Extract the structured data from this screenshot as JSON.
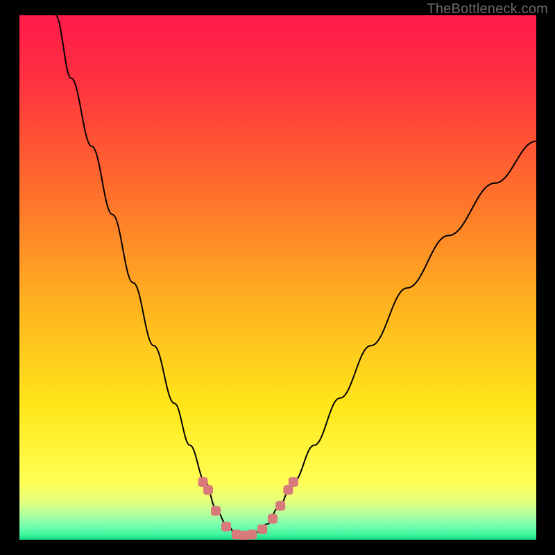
{
  "watermark": "TheBottleneck.com",
  "gradient": {
    "c0": "#ff1a4a",
    "c1": "#ff3040",
    "c2": "#ff6a2d",
    "c3": "#ffb21f",
    "c4": "#ffe81a",
    "c5": "#ffff55",
    "c6": "#e8ff7a",
    "c7": "#b6ff9a",
    "c8": "#7fffb0",
    "c9": "#40f7a0",
    "c10": "#17d884"
  },
  "chart_data": {
    "type": "line",
    "title": "",
    "xlabel": "",
    "ylabel": "",
    "xlim": [
      0,
      100
    ],
    "ylim": [
      0,
      100
    ],
    "grid": false,
    "legend": false,
    "series": [
      {
        "name": "bottleneck-curve",
        "color": "#000000",
        "x": [
          7,
          10,
          14,
          18,
          22,
          26,
          30,
          33,
          36,
          38,
          40,
          42,
          43.5,
          45,
          48,
          50,
          53,
          57,
          62,
          68,
          75,
          83,
          92,
          100
        ],
        "y": [
          100,
          88,
          75,
          62,
          49,
          37,
          26,
          18,
          11,
          6,
          3,
          1,
          0.5,
          1,
          3,
          6,
          11,
          18,
          27,
          37,
          48,
          58,
          68,
          76
        ]
      },
      {
        "name": "highlight-dots",
        "color": "#d97a7a",
        "type": "scatter",
        "x": [
          35.5,
          36.5,
          38.0,
          40.0,
          42.0,
          43.5,
          45.0,
          47.0,
          49.0,
          50.5,
          52.0,
          53.0
        ],
        "y": [
          11.0,
          9.5,
          5.5,
          2.5,
          1.0,
          0.8,
          1.0,
          2.0,
          4.0,
          6.5,
          9.5,
          11.0
        ]
      }
    ],
    "annotations": []
  }
}
